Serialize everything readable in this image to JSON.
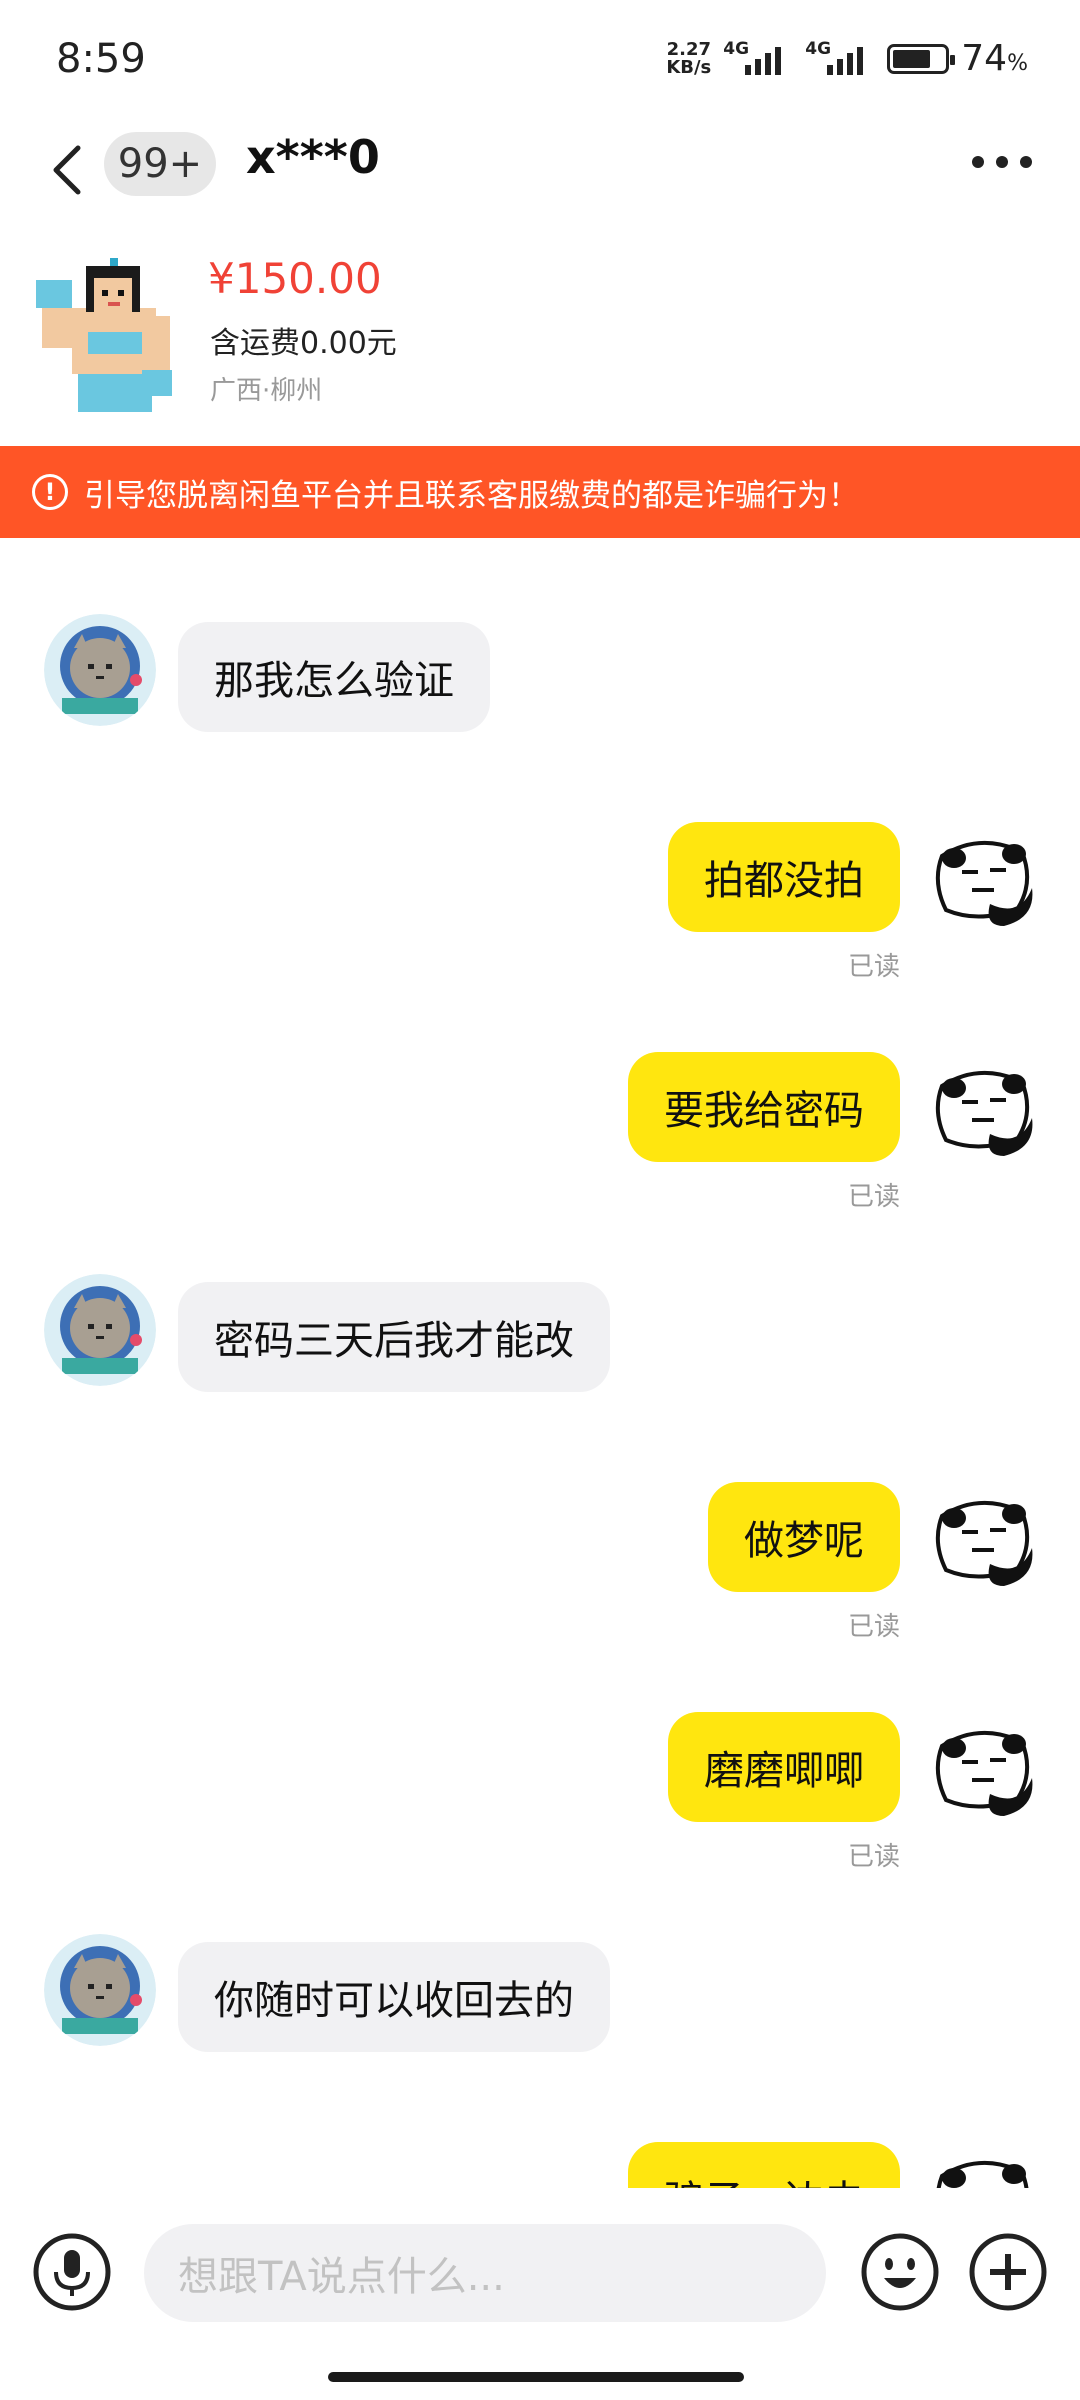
{
  "status_bar": {
    "time": "8:59",
    "net_speed_value": "2.27",
    "net_speed_unit": "KB/s",
    "sim1_label": "4G",
    "sim2_label": "4G",
    "battery_percent": "74",
    "battery_unit": "%",
    "battery_level": 0.74
  },
  "header": {
    "unread_badge": "99+",
    "contact_name": "x***0"
  },
  "product": {
    "price": "¥150.00",
    "shipping": "含运费0.00元",
    "location": "广西·柳州"
  },
  "warning": {
    "icon": "!",
    "text": "引导您脱离闲鱼平台并且联系客服缴费的都是诈骗行为！"
  },
  "messages": [
    {
      "side": "in",
      "text": "那我怎么验证"
    },
    {
      "side": "out",
      "text": "拍都没拍",
      "status": "已读"
    },
    {
      "side": "out",
      "text": "要我给密码",
      "status": "已读"
    },
    {
      "side": "in",
      "text": "密码三天后我才能改"
    },
    {
      "side": "out",
      "text": "做梦呢",
      "status": "已读"
    },
    {
      "side": "out",
      "text": "磨磨唧唧",
      "status": "已读"
    },
    {
      "side": "in",
      "text": "你随时可以收回去的"
    },
    {
      "side": "out",
      "text": "骗子一边去"
    }
  ],
  "input": {
    "placeholder": "想跟TA说点什么..."
  },
  "colors": {
    "accent_yellow": "#ffe60f",
    "warning_orange": "#ff5526",
    "price_red": "#f04236",
    "incoming_bubble": "#f1f1f3"
  },
  "icons": {
    "back": "chevron-left-icon",
    "more": "more-dots-icon",
    "mic": "microphone-icon",
    "emoji": "emoji-icon",
    "plus": "plus-icon"
  }
}
